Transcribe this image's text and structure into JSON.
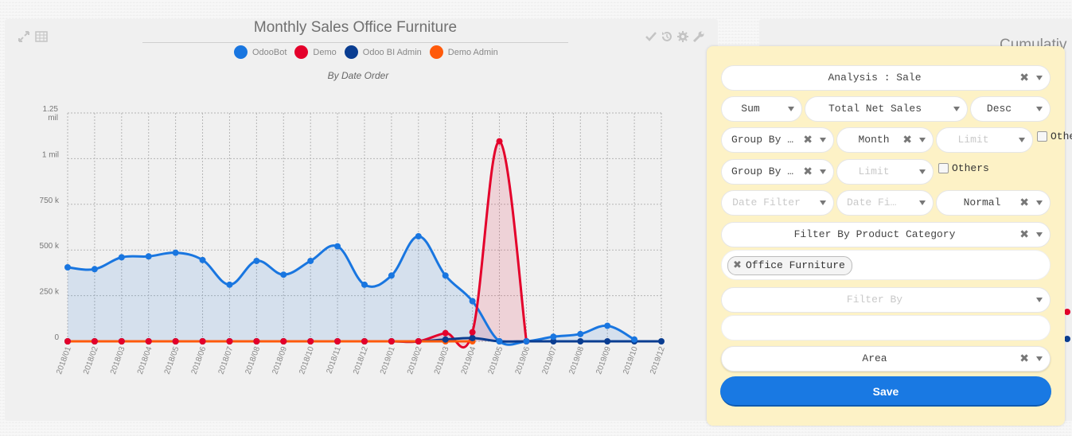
{
  "colors": {
    "odoobot": "#1976e0",
    "demo": "#e4002b",
    "bi_admin": "#0a3d91",
    "demo_admin": "#ff5a0b",
    "panel_bg": "#fdf2c6",
    "save": "#1979e3"
  },
  "right_card": {
    "title": "Cumulativ"
  },
  "chart_data": {
    "type": "area",
    "title": "Monthly Sales Office Furniture",
    "subtitle": "By Date Order",
    "categories": [
      "2018/01",
      "2018/02",
      "2018/03",
      "2018/04",
      "2018/05",
      "2018/06",
      "2018/07",
      "2018/08",
      "2018/09",
      "2018/10",
      "2018/11",
      "2018/12",
      "2019/01",
      "2019/02",
      "2019/03",
      "2019/04",
      "2019/05",
      "2019/06",
      "2019/07",
      "2019/08",
      "2019/09",
      "2019/10",
      "2019/12"
    ],
    "y_ticks": [
      {
        "value": 0,
        "label": "0"
      },
      {
        "value": 250000,
        "label": "250 k"
      },
      {
        "value": 500000,
        "label": "500 k"
      },
      {
        "value": 750000,
        "label": "750 k"
      },
      {
        "value": 1000000,
        "label": "1 mil"
      },
      {
        "value": 1250000,
        "label": "1.25 mil"
      }
    ],
    "ylim": [
      0,
      1250000
    ],
    "grid": true,
    "series": [
      {
        "name": "OdooBot",
        "color": "#1976e0",
        "fill": "rgba(25,118,224,0.12)",
        "values": [
          405000,
          395000,
          460000,
          465000,
          485000,
          445000,
          310000,
          440000,
          365000,
          440000,
          520000,
          310000,
          360000,
          575000,
          360000,
          220000,
          0,
          0,
          25000,
          40000,
          85000,
          10000,
          null
        ]
      },
      {
        "name": "Demo",
        "color": "#e4002b",
        "fill": "rgba(228,0,43,0.12)",
        "values": [
          0,
          0,
          0,
          0,
          0,
          0,
          0,
          0,
          0,
          0,
          0,
          0,
          0,
          0,
          45000,
          50000,
          1095000,
          0,
          null,
          null,
          null,
          null,
          null
        ]
      },
      {
        "name": "Odoo BI Admin",
        "color": "#0a3d91",
        "fill": "none",
        "values": [
          0,
          0,
          0,
          0,
          0,
          0,
          0,
          0,
          0,
          0,
          0,
          0,
          0,
          0,
          10000,
          18000,
          0,
          0,
          0,
          0,
          0,
          0,
          0
        ]
      },
      {
        "name": "Demo Admin",
        "color": "#ff5a0b",
        "fill": "none",
        "values": [
          0,
          0,
          0,
          0,
          0,
          0,
          0,
          0,
          0,
          0,
          0,
          0,
          0,
          0,
          0,
          0,
          null,
          null,
          null,
          null,
          null,
          null,
          null
        ]
      }
    ]
  },
  "panel": {
    "analysis": "Analysis : Sale",
    "measure_op": "Sum",
    "measure_field": "Total Net Sales",
    "sort": "Desc",
    "group_by_date": "Group By D…",
    "date_interval": "Month",
    "limit_1_placeholder": "Limit",
    "others_1": "Othe",
    "group_by_second": "Group By S…",
    "limit_2_placeholder": "Limit",
    "others_2": "Others",
    "date_filter_1_placeholder": "Date Filter",
    "date_filter_2_placeholder": "Date Filter",
    "mode": "Normal",
    "filter_by_category": "Filter By Product Category",
    "tag": "Office Furniture",
    "filter_by_placeholder": "Filter By",
    "chart_type": "Area",
    "save": "Save"
  }
}
